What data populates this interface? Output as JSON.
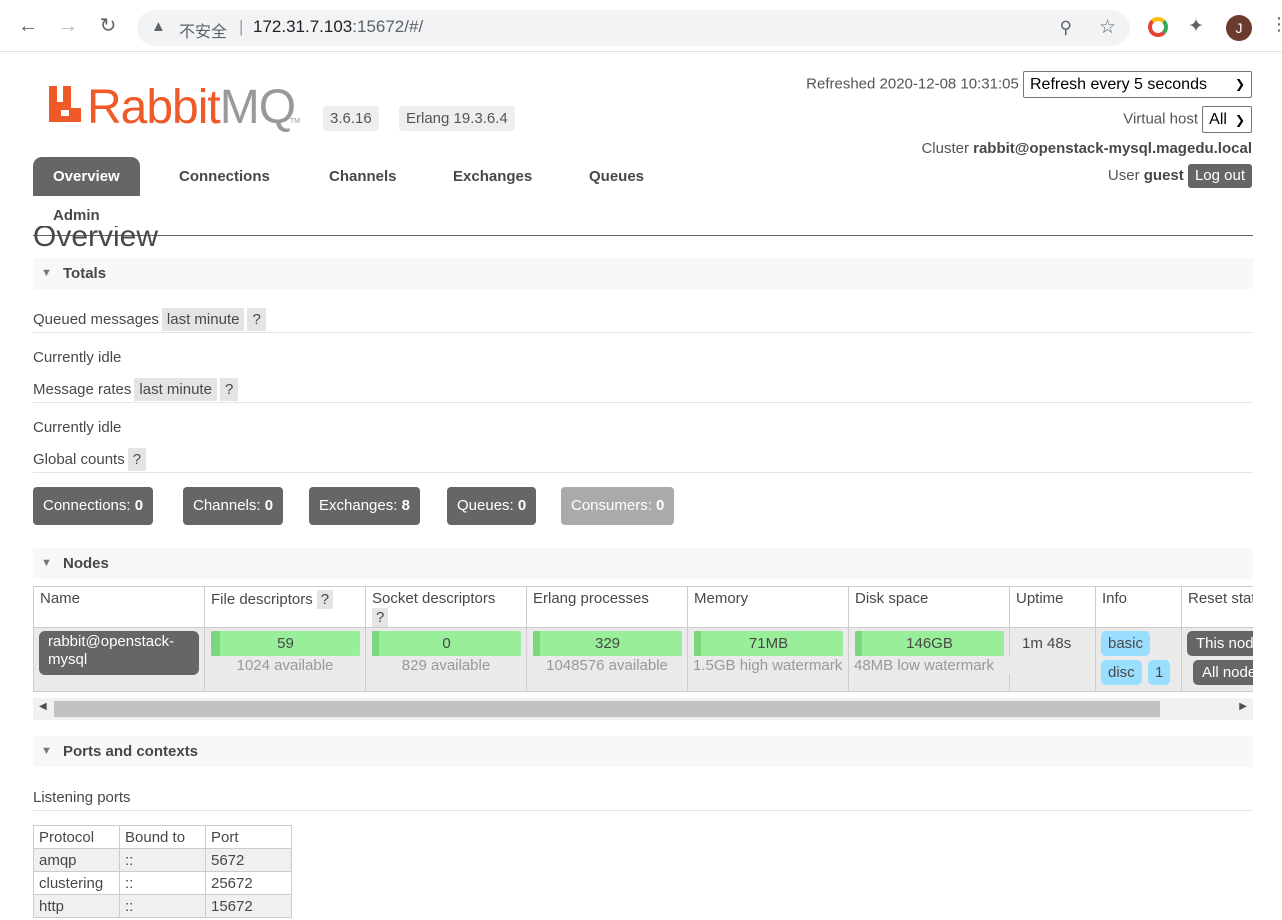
{
  "browser": {
    "security_label": "不安全",
    "url_host": "172.31.7.103",
    "url_rest": ":15672/#/",
    "avatar_letter": "J",
    "icons": [
      "back-arrow-icon",
      "forward-arrow-icon",
      "reload-icon",
      "warning-icon",
      "key-icon",
      "star-icon",
      "chrome-extension-icon",
      "puzzle-icon",
      "more-icon"
    ]
  },
  "header": {
    "logo_rabbit": "Rabbit",
    "logo_mq": "MQ",
    "logo_tm": "TM",
    "version": "3.6.16",
    "erlang": "Erlang 19.3.6.4",
    "refreshed_label": "Refreshed",
    "refreshed_time": "2020-12-08 10:31:05",
    "refresh_select": "Refresh every 5 seconds",
    "vhost_label": "Virtual host",
    "vhost_select": "All",
    "cluster_label": "Cluster",
    "cluster_name": "rabbit@openstack-mysql.magedu.local",
    "user_label": "User",
    "user_name": "guest",
    "logout": "Log out"
  },
  "tabs": [
    "Overview",
    "Connections",
    "Channels",
    "Exchanges",
    "Queues",
    "Admin"
  ],
  "page_title": "Overview",
  "totals": {
    "heading": "Totals",
    "queued_label": "Queued messages",
    "queued_tag": "last minute",
    "help": "?",
    "idle1": "Currently idle",
    "rates_label": "Message rates",
    "rates_tag": "last minute",
    "idle2": "Currently idle",
    "global_label": "Global counts"
  },
  "counts": [
    {
      "label": "Connections:",
      "value": "0"
    },
    {
      "label": "Channels:",
      "value": "0"
    },
    {
      "label": "Exchanges:",
      "value": "8"
    },
    {
      "label": "Queues:",
      "value": "0"
    },
    {
      "label": "Consumers:",
      "value": "0"
    }
  ],
  "nodes": {
    "heading": "Nodes",
    "columns": [
      "Name",
      "File descriptors",
      "Socket descriptors",
      "Erlang processes",
      "Memory",
      "Disk space",
      "Uptime",
      "Info",
      "Reset stats"
    ],
    "row": {
      "name_line1": "rabbit@openstack-",
      "name_line2": "mysql",
      "fd": {
        "value": "59",
        "sub": "1024 available",
        "fraction": 0.058
      },
      "sockets": {
        "value": "0",
        "sub": "829 available",
        "fraction": 0.0
      },
      "procs": {
        "value": "329",
        "sub": "1048576 available",
        "fraction": 0.0003
      },
      "memory": {
        "value": "71MB",
        "sub": "1.5GB high watermark",
        "fraction": 0.046
      },
      "disk": {
        "value": "146GB",
        "sub": "48MB low watermark",
        "fraction": 0.0
      },
      "uptime": "1m 48s",
      "info": [
        "basic",
        "disc",
        "1"
      ],
      "reset": [
        "This node",
        "All nodes"
      ]
    }
  },
  "ports": {
    "heading": "Ports and contexts",
    "listening_label": "Listening ports",
    "headers": [
      "Protocol",
      "Bound to",
      "Port"
    ],
    "rows": [
      [
        "amqp",
        "::",
        "5672"
      ],
      [
        "clustering",
        "::",
        "25672"
      ],
      [
        "http",
        "::",
        "15672"
      ]
    ]
  },
  "colors": {
    "accent": "#f05a28",
    "dark": "#666666",
    "bar": "#99ee99",
    "info": "#99ddff"
  }
}
